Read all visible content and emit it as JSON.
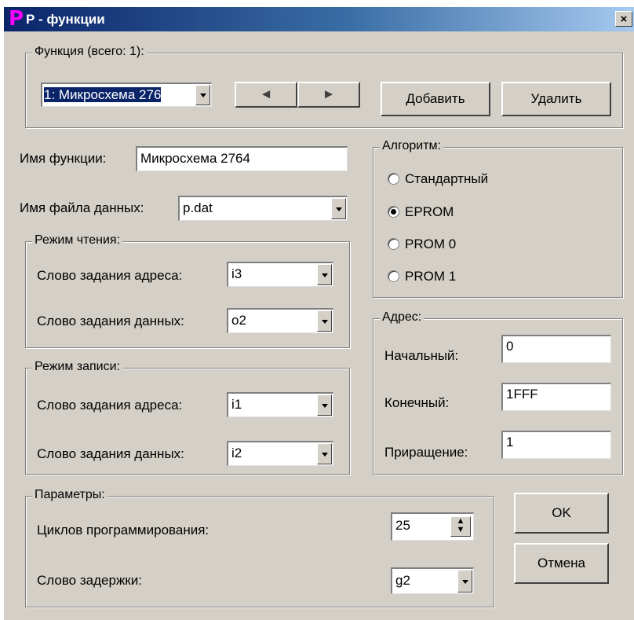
{
  "window": {
    "title": "Р - функции",
    "logo": "P",
    "close_label": "×"
  },
  "function_group": {
    "legend": "Функция (всего: 1):",
    "selected": "1: Микросхема 276",
    "prev_icon": "◄",
    "next_icon": "►",
    "add_label": "Добавить",
    "delete_label": "Удалить"
  },
  "function_name": {
    "label": "Имя функции:",
    "value": "Микросхема 2764"
  },
  "data_file": {
    "label": "Имя файла данных:",
    "value": "p.dat"
  },
  "read_mode": {
    "legend": "Режим чтения:",
    "address_label": "Слово задания адреса:",
    "address_value": "i3",
    "data_label": "Слово задания данных:",
    "data_value": "o2"
  },
  "write_mode": {
    "legend": "Режим записи:",
    "address_label": "Слово задания адреса:",
    "address_value": "i1",
    "data_label": "Слово задания данных:",
    "data_value": "i2"
  },
  "algorithm": {
    "legend": "Алгоритм:",
    "options": [
      "Стандартный",
      "EPROM",
      "PROM 0",
      "PROM 1"
    ],
    "selected": "EPROM"
  },
  "address": {
    "legend": "Адрес:",
    "start_label": "Начальный:",
    "start_value": "0",
    "end_label": "Конечный:",
    "end_value": "1FFF",
    "step_label": "Приращение:",
    "step_value": "1"
  },
  "parameters": {
    "legend": "Параметры:",
    "cycles_label": "Циклов программирования:",
    "cycles_value": "25",
    "delay_label": "Слово задержки:",
    "delay_value": "g2"
  },
  "buttons": {
    "ok": "OK",
    "cancel": "Отмена"
  }
}
